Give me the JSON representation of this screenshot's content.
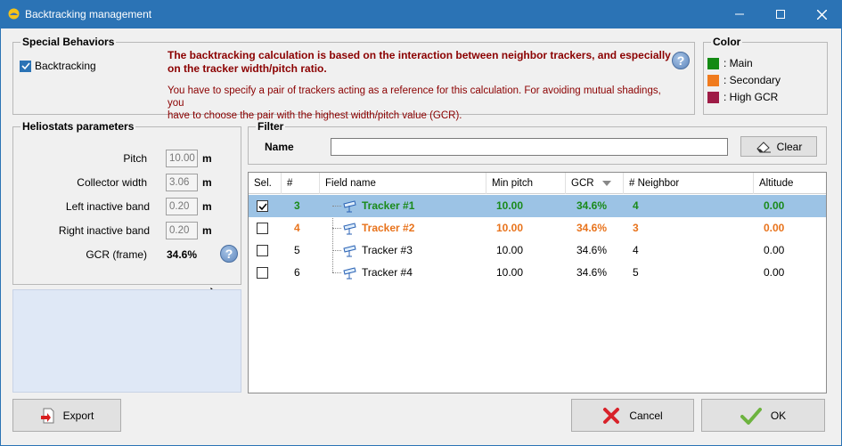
{
  "window": {
    "title": "Backtracking management"
  },
  "special": {
    "legend": "Special Behaviors",
    "checkbox_label": "Backtracking",
    "bold_text_line1": "The backtracking calculation is based on the interaction between neighbor trackers, and especially",
    "bold_text_line2": "on the tracker width/pitch ratio.",
    "info_line1": "You have to specify a pair of trackers acting as a reference for this calculation. For avoiding mutual shadings, you",
    "info_line2": "have to choose the pair with the highest width/pitch value (GCR)."
  },
  "color": {
    "legend": "Color",
    "items": [
      {
        "label": ": Main",
        "color": "#138a13"
      },
      {
        "label": ": Secondary",
        "color": "#f07b1e"
      },
      {
        "label": ": High GCR",
        "color": "#9e1c46"
      }
    ]
  },
  "heliostats": {
    "legend": "Heliostats parameters",
    "pitch_label": "Pitch",
    "pitch_value": "10.00",
    "pitch_unit": "m",
    "collector_label": "Collector width",
    "collector_value": "3.06",
    "collector_unit": "m",
    "left_label": "Left inactive band",
    "left_value": "0.20",
    "left_unit": "m",
    "right_label": "Right inactive band",
    "right_value": "0.20",
    "right_unit": "m",
    "gcr_label": "GCR (frame)",
    "gcr_value": "34.6%"
  },
  "filter": {
    "legend": "Filter",
    "name_label": "Name",
    "name_value": "",
    "clear_label": "Clear"
  },
  "table": {
    "headers": [
      "Sel.",
      "#",
      "Field name",
      "Min pitch",
      "GCR",
      "# Neighbor",
      "Altitude"
    ],
    "rows": [
      {
        "sel": true,
        "num": "3",
        "name": "Tracker #1",
        "min_pitch": "10.00",
        "gcr": "34.6%",
        "neighbor": "4",
        "altitude": "0.00",
        "style": "green"
      },
      {
        "sel": false,
        "num": "4",
        "name": "Tracker #2",
        "min_pitch": "10.00",
        "gcr": "34.6%",
        "neighbor": "3",
        "altitude": "0.00",
        "style": "orange"
      },
      {
        "sel": false,
        "num": "5",
        "name": "Tracker #3",
        "min_pitch": "10.00",
        "gcr": "34.6%",
        "neighbor": "4",
        "altitude": "0.00",
        "style": ""
      },
      {
        "sel": false,
        "num": "6",
        "name": "Tracker #4",
        "min_pitch": "10.00",
        "gcr": "34.6%",
        "neighbor": "5",
        "altitude": "0.00",
        "style": ""
      }
    ]
  },
  "buttons": {
    "export": "Export",
    "cancel": "Cancel",
    "ok": "OK"
  },
  "help_glyph": "?"
}
